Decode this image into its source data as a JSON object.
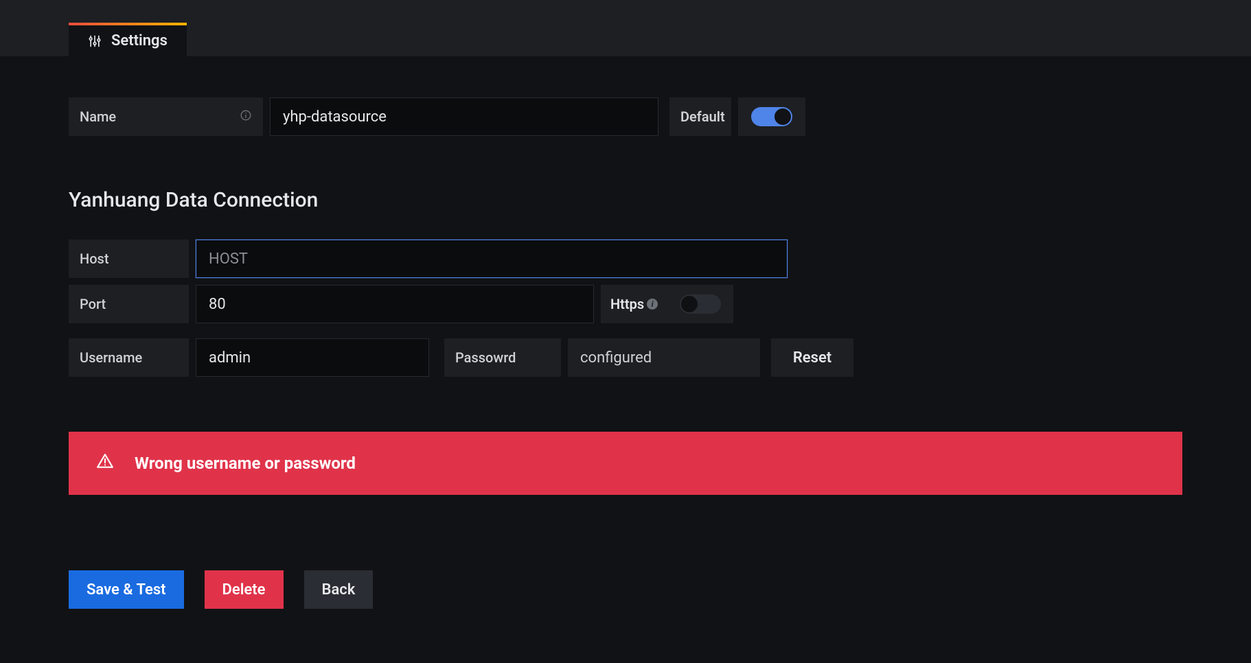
{
  "tabs": {
    "settings_label": "Settings"
  },
  "name_row": {
    "label": "Name",
    "value": "yhp-datasource",
    "default_label": "Default",
    "default_on": true
  },
  "section_title": "Yanhuang Data Connection",
  "host_row": {
    "label": "Host",
    "placeholder": "HOST",
    "value": ""
  },
  "port_row": {
    "label": "Port",
    "value": "80",
    "https_label": "Https",
    "https_on": false
  },
  "auth_row": {
    "username_label": "Username",
    "username_value": "admin",
    "password_label": "Passowrd",
    "password_value": "configured",
    "reset_label": "Reset"
  },
  "alert": {
    "message": "Wrong username or password"
  },
  "footer": {
    "save_label": "Save & Test",
    "delete_label": "Delete",
    "back_label": "Back"
  }
}
